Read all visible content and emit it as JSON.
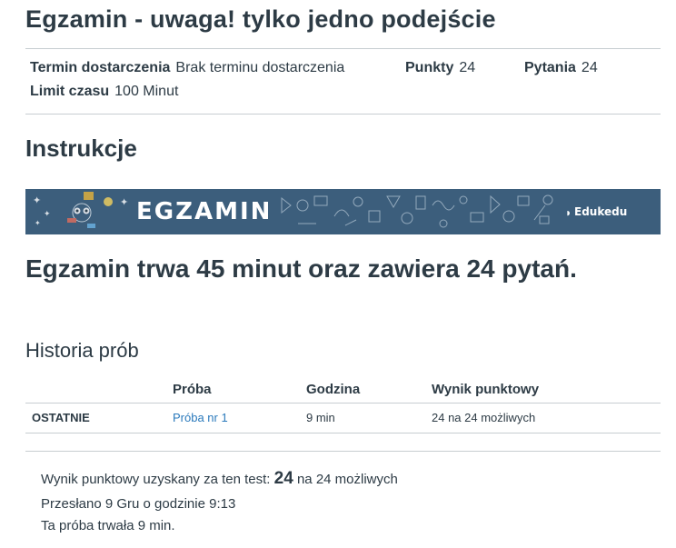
{
  "title": "Egzamin - uwaga! tylko jedno podejście",
  "details": {
    "due_label": "Termin dostarczenia",
    "due_value": "Brak terminu dostarczenia",
    "points_label": "Punkty",
    "points_value": "24",
    "questions_label": "Pytania",
    "questions_value": "24",
    "time_label": "Limit czasu",
    "time_value": "100 Minut"
  },
  "instructions": {
    "heading": "Instrukcje",
    "banner_title": "EGZAMIN",
    "banner_brand": "Edukedu",
    "main_text": "Egzamin trwa 45 minut oraz zawiera 24 pytań."
  },
  "history": {
    "heading": "Historia prób",
    "columns": [
      "Próba",
      "Godzina",
      "Wynik punktowy"
    ],
    "rows": [
      {
        "label": "OSTATNIE",
        "attempt": "Próba nr 1",
        "time": "9 min",
        "score": "24 na 24 możliwych"
      }
    ]
  },
  "summary": {
    "score_prefix": "Wynik punktowy uzyskany za ten test:",
    "score": "24",
    "score_suffix": "na 24 możliwych",
    "submitted": "Przesłano 9 Gru o godzinie 9:13",
    "duration": "Ta próba trwała 9 min."
  },
  "colors": {
    "text": "#2d3b45",
    "link": "#2b7abc",
    "banner_bg": "#3c5e7c",
    "rule": "#c7cdd1"
  }
}
